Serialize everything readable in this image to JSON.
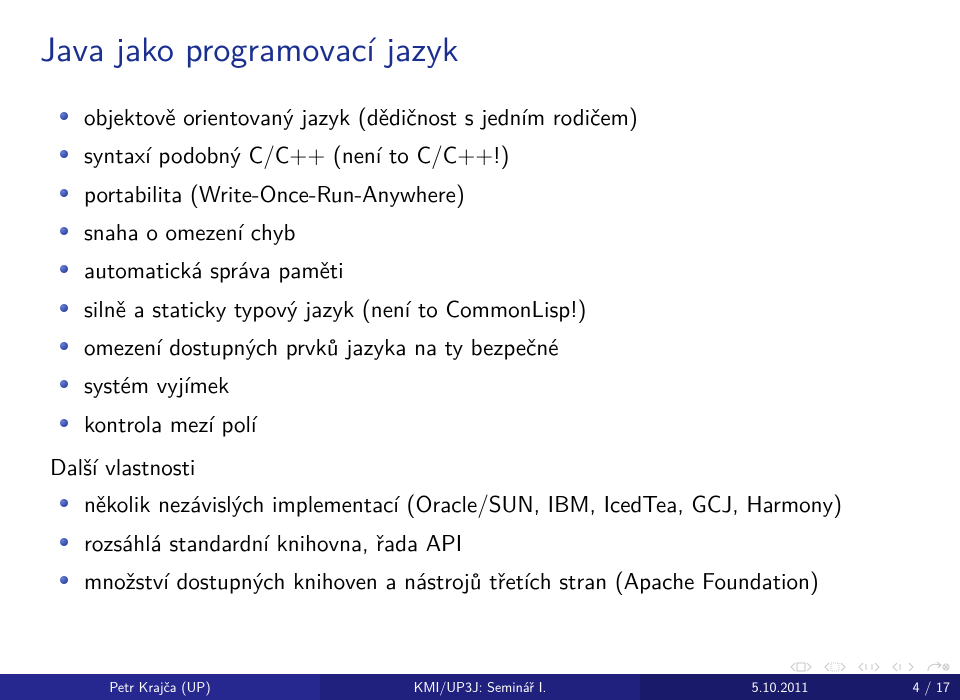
{
  "title": "Java jako programovací jazyk",
  "list1": {
    "i0": "objektově orientovaný jazyk (dědičnost s jedním rodičem)",
    "i1": "syntaxí podobný C/C++ (není to C/C++!)",
    "i2": "portabilita (Write-Once-Run-Anywhere)",
    "i3": "snaha o omezení chyb",
    "i4": "automatická správa paměti",
    "i5": "silně a staticky typový jazyk (není to CommonLisp!)",
    "i6": "omezení dostupných prvků jazyka na ty bezpečné",
    "i7": "systém vyjímek",
    "i8": "kontrola mezí polí"
  },
  "subhead": "Další vlastnosti",
  "list2": {
    "i0": "několik nezávislých implementací (Oracle/SUN, IBM, IcedTea, GCJ, Harmony)",
    "i1": "rozsáhlá standardní knihovna, řada API",
    "i2": "množství dostupných knihoven a nástrojů třetích stran (Apache Foundation)"
  },
  "footer": {
    "author": "Petr Krajča (UP)",
    "center": "KMI/UP3J: Seminář I.",
    "date": "5.10.2011",
    "page": "4 / 17"
  }
}
